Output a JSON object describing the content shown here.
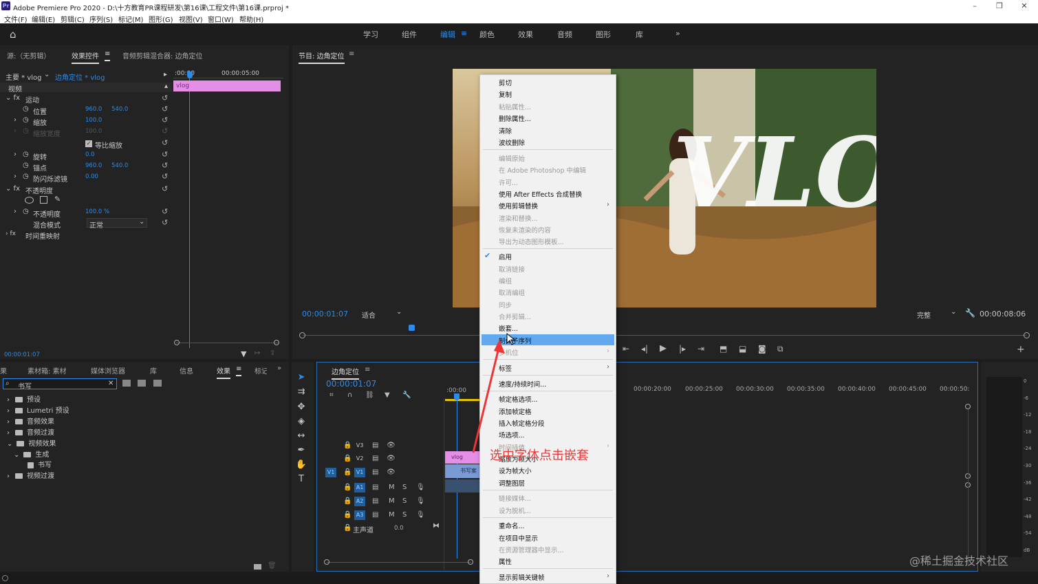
{
  "app": {
    "title": "Adobe Premiere Pro 2020 - D:\\十方教育PR课程研发\\第16课\\工程文件\\第16课.prproj *",
    "logo_text": "Pr"
  },
  "menu": [
    "文件(F)",
    "编辑(E)",
    "剪辑(C)",
    "序列(S)",
    "标记(M)",
    "图形(G)",
    "视图(V)",
    "窗口(W)",
    "帮助(H)"
  ],
  "workspaces": {
    "tabs": [
      "学习",
      "组件",
      "编辑",
      "颜色",
      "效果",
      "音频",
      "图形",
      "库"
    ],
    "active": "编辑",
    "more": "»"
  },
  "effect_controls": {
    "tabs": [
      "源:（无剪辑）",
      "效果控件",
      "音频剪辑混合器: 边角定位"
    ],
    "active_tab": "效果控件",
    "master_label": "主要 * vlog",
    "sequence_label": "边角定位 * vlog",
    "ruler_start": ":00:00",
    "ruler_mid": "00:00:05:00",
    "clip_label": "vlog",
    "section_video": "视频",
    "motion": "运动",
    "position_label": "位置",
    "position_x": "960.0",
    "position_y": "540.0",
    "scale_label": "缩放",
    "scale_value": "100.0",
    "scale_width_label": "缩放宽度",
    "scale_width_value": "100.0",
    "uniform_scale_label": "等比缩放",
    "rotation_label": "旋转",
    "rotation_value": "0.0",
    "anchor_label": "锚点",
    "anchor_x": "960.0",
    "anchor_y": "540.0",
    "antiflicker_label": "防闪烁滤镜",
    "antiflicker_value": "0.00",
    "opacity_section": "不透明度",
    "opacity_label": "不透明度",
    "opacity_value": "100.0 %",
    "blend_label": "混合模式",
    "blend_value": "正常",
    "time_remap": "时间重映射",
    "timecode": "00:00:01:07"
  },
  "program_monitor": {
    "title": "节目: 边角定位",
    "timecode": "00:00:01:07",
    "fit_label": "适合",
    "quality_label": "完整",
    "duration": "00:00:08:06",
    "overlay_text": "VLOG"
  },
  "context_menu": {
    "items": [
      {
        "label": "剪切",
        "enabled": true
      },
      {
        "label": "复制",
        "enabled": true
      },
      {
        "label": "粘贴属性...",
        "enabled": false
      },
      {
        "label": "删除属性...",
        "enabled": true
      },
      {
        "label": "清除",
        "enabled": true
      },
      {
        "label": "波纹删除",
        "enabled": true
      },
      {
        "label": "编辑原始",
        "enabled": false
      },
      {
        "label": "在 Adobe Photoshop 中编辑",
        "enabled": false
      },
      {
        "label": "许可...",
        "enabled": false
      },
      {
        "label": "使用 After Effects 合成替换",
        "enabled": true
      },
      {
        "label": "使用剪辑替换",
        "enabled": true
      },
      {
        "label": "渲染和替换...",
        "enabled": false
      },
      {
        "label": "恢复未渲染的内容",
        "enabled": false
      },
      {
        "label": "导出为动态图形模板...",
        "enabled": false
      },
      {
        "label": "启用",
        "enabled": true
      },
      {
        "label": "取消链接",
        "enabled": false
      },
      {
        "label": "编组",
        "enabled": false
      },
      {
        "label": "取消编组",
        "enabled": false
      },
      {
        "label": "同步",
        "enabled": false
      },
      {
        "label": "合并剪辑...",
        "enabled": false
      },
      {
        "label": "嵌套...",
        "enabled": true
      },
      {
        "label": "制作子序列",
        "enabled": true
      },
      {
        "label": "多机位",
        "enabled": false
      },
      {
        "label": "标签",
        "enabled": true
      },
      {
        "label": "速度/持续时间...",
        "enabled": true
      },
      {
        "label": "帧定格选项...",
        "enabled": true
      },
      {
        "label": "添加帧定格",
        "enabled": true
      },
      {
        "label": "插入帧定格分段",
        "enabled": true
      },
      {
        "label": "场选项...",
        "enabled": true
      },
      {
        "label": "时间插值",
        "enabled": false
      },
      {
        "label": "缩放为帧大小",
        "enabled": true
      },
      {
        "label": "设为帧大小",
        "enabled": true
      },
      {
        "label": "调整图层",
        "enabled": true
      },
      {
        "label": "链接媒体...",
        "enabled": false
      },
      {
        "label": "设为脱机...",
        "enabled": false
      },
      {
        "label": "重命名...",
        "enabled": true
      },
      {
        "label": "在项目中显示",
        "enabled": true
      },
      {
        "label": "在资源管理器中显示...",
        "enabled": false
      },
      {
        "label": "属性",
        "enabled": true
      },
      {
        "label": "显示剪辑关键帧",
        "enabled": true
      }
    ]
  },
  "effects_panel": {
    "tabs": [
      "素材箱: 素材",
      "媒体浏览器",
      "库",
      "信息",
      "效果",
      "标记"
    ],
    "active_tab": "效果",
    "search_value": "书写",
    "tree": [
      {
        "label": "预设",
        "level": 0
      },
      {
        "label": "Lumetri 预设",
        "level": 0
      },
      {
        "label": "音频效果",
        "level": 0
      },
      {
        "label": "音频过渡",
        "level": 0
      },
      {
        "label": "视频效果",
        "level": 0
      },
      {
        "label": "生成",
        "level": 1
      },
      {
        "label": "书写",
        "level": 2
      },
      {
        "label": "视频过渡",
        "level": 0
      }
    ]
  },
  "timeline": {
    "title": "边角定位",
    "timecode": "00:00:01:07",
    "ruler": [
      ":00:00",
      "00:00:20:00",
      "00:00:25:00",
      "00:00:30:00",
      "00:00:35:00",
      "00:00:40:00",
      "00:00:45:00",
      "00:00:50:"
    ],
    "tracks": [
      "V3",
      "V2",
      "V1",
      "A1",
      "A2",
      "A3"
    ],
    "source_patch": "V1",
    "master_label": "主声道",
    "master_value": "0.0",
    "clip_v2": "vlog",
    "clip_v1": "书写案",
    "meter_scale": [
      "0",
      "-6",
      "-12",
      "-18",
      "-24",
      "-30",
      "-36",
      "-42",
      "-48",
      "-54",
      "dB"
    ]
  },
  "annotation": "选中字体点击嵌套",
  "watermark": "@稀土掘金技术社区",
  "colors": {
    "accent_blue": "#2d8ceb",
    "clip_pink": "#e58ee5",
    "annotation_red": "#ee3535",
    "menu_highlight": "#63a9f0"
  }
}
